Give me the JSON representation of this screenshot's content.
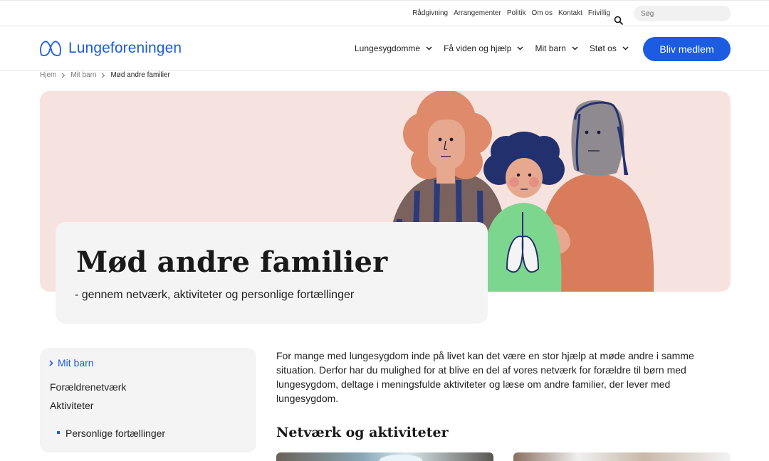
{
  "utility_nav": [
    "Rådgivning",
    "Arrangementer",
    "Politik",
    "Om os",
    "Kontakt",
    "Frivillig"
  ],
  "search": {
    "placeholder": "Søg"
  },
  "logo": {
    "text": "Lungeforeningen"
  },
  "main_nav": [
    "Lungesygdomme",
    "Få viden og hjælp",
    "Mit barn",
    "Støt os"
  ],
  "cta": {
    "label": "Bliv medlem"
  },
  "breadcrumb": {
    "home": "Hjem",
    "parent": "Mit barn",
    "current": "Mød andre familier"
  },
  "hero": {
    "title": "Mød andre familier",
    "subtitle": "- gennem netværk, aktiviteter og personlige fortællinger"
  },
  "side_menu": {
    "active": "Mit barn",
    "items": [
      "Forældrenetværk",
      "Aktiviteter"
    ],
    "sub_items": [
      "Personlige fortællinger"
    ]
  },
  "intro_text": "For mange med lungesygdom inde på livet kan det være en stor hjælp at møde andre i samme situation. Derfor har du mulighed for at blive en del af vores netværk for forældre til børn med lungesygdom, deltage i meningsfulde aktiviteter og læse om andre familier, der lever med lungesygdom.",
  "section_heading": "Netværk og aktiviteter",
  "colors": {
    "brand": "#1b5ce0",
    "hero_bg": "#f6e2de",
    "card_bg": "#f4f4f4"
  }
}
